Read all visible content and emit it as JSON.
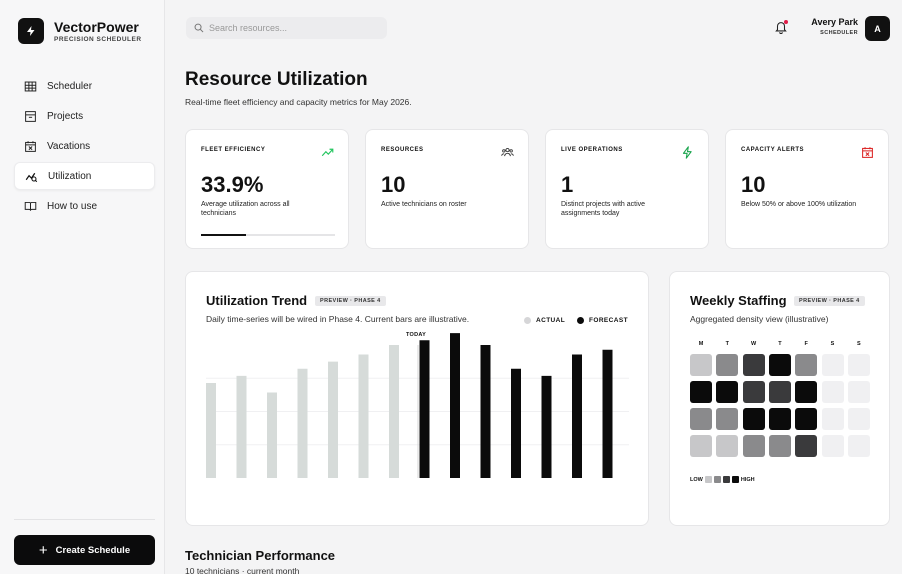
{
  "brand": {
    "name": "VectorPower",
    "subtitle": "PRECISION SCHEDULER"
  },
  "nav": {
    "items": [
      {
        "label": "Scheduler",
        "icon": "grid-icon",
        "active": false
      },
      {
        "label": "Projects",
        "icon": "archive-icon",
        "active": false
      },
      {
        "label": "Vacations",
        "icon": "calendar-x-icon",
        "active": false
      },
      {
        "label": "Utilization",
        "icon": "trend-icon",
        "active": true
      },
      {
        "label": "How to use",
        "icon": "book-icon",
        "active": false
      }
    ]
  },
  "create_button": {
    "label": "Create Schedule"
  },
  "search": {
    "placeholder": "Search resources..."
  },
  "user": {
    "name": "Avery Park",
    "role": "SCHEDULER",
    "initial": "A"
  },
  "page": {
    "title": "Resource Utilization",
    "subtitle": "Real-time fleet efficiency and capacity metrics for May 2026."
  },
  "kpis": [
    {
      "label": "FLEET EFFICIENCY",
      "value": "33.9%",
      "desc": "Average utilization across all technicians",
      "icon": "trend-up-icon",
      "icon_color": "#22c55e",
      "progress": 0.339
    },
    {
      "label": "RESOURCES",
      "value": "10",
      "desc": "Active technicians on roster",
      "icon": "users-icon",
      "icon_color": "#333333"
    },
    {
      "label": "LIVE OPERATIONS",
      "value": "1",
      "desc": "Distinct projects with active assignments today",
      "icon": "bolt-icon",
      "icon_color": "#16a34a"
    },
    {
      "label": "CAPACITY ALERTS",
      "value": "10",
      "desc": "Below 50% or above 100% utilization",
      "icon": "calendar-alert-icon",
      "icon_color": "#dc2626"
    }
  ],
  "trend": {
    "title": "Utilization Trend",
    "badge": "PREVIEW · PHASE 4",
    "subtitle": "Daily time-series will be wired in Phase 4. Current bars are illustrative.",
    "legend_actual": "ACTUAL",
    "legend_forecast": "FORECAST",
    "today_label": "TODAY",
    "colors": {
      "actual": "#d6dbd9",
      "forecast": "#0b0b0b"
    },
    "chart_data": {
      "type": "bar",
      "series": [
        {
          "name": "ACTUAL",
          "values": [
            40,
            43,
            36,
            46,
            49,
            52,
            56
          ]
        },
        {
          "name": "FORECAST",
          "values": [
            58,
            61,
            56,
            46,
            43,
            52,
            54
          ]
        }
      ],
      "ylim": [
        0,
        70
      ]
    }
  },
  "staffing": {
    "title": "Weekly Staffing",
    "badge": "PREVIEW · PHASE 4",
    "subtitle": "Aggregated density view (illustrative)",
    "days": [
      "M",
      "T",
      "W",
      "T",
      "F",
      "S",
      "S"
    ],
    "grid": [
      [
        1,
        2,
        3,
        4,
        2,
        0,
        0
      ],
      [
        4,
        4,
        3,
        3,
        4,
        0,
        0
      ],
      [
        2,
        2,
        4,
        4,
        4,
        0,
        0
      ],
      [
        1,
        1,
        2,
        2,
        3,
        0,
        0
      ]
    ],
    "palette": [
      "#f0f0f2",
      "#c7c7c9",
      "#8a8a8c",
      "#3a3a3c",
      "#0b0b0b"
    ],
    "density_low": "LOW",
    "density_high": "HIGH"
  },
  "performance": {
    "title": "Technician Performance",
    "subtitle": "10 technicians · current month"
  }
}
